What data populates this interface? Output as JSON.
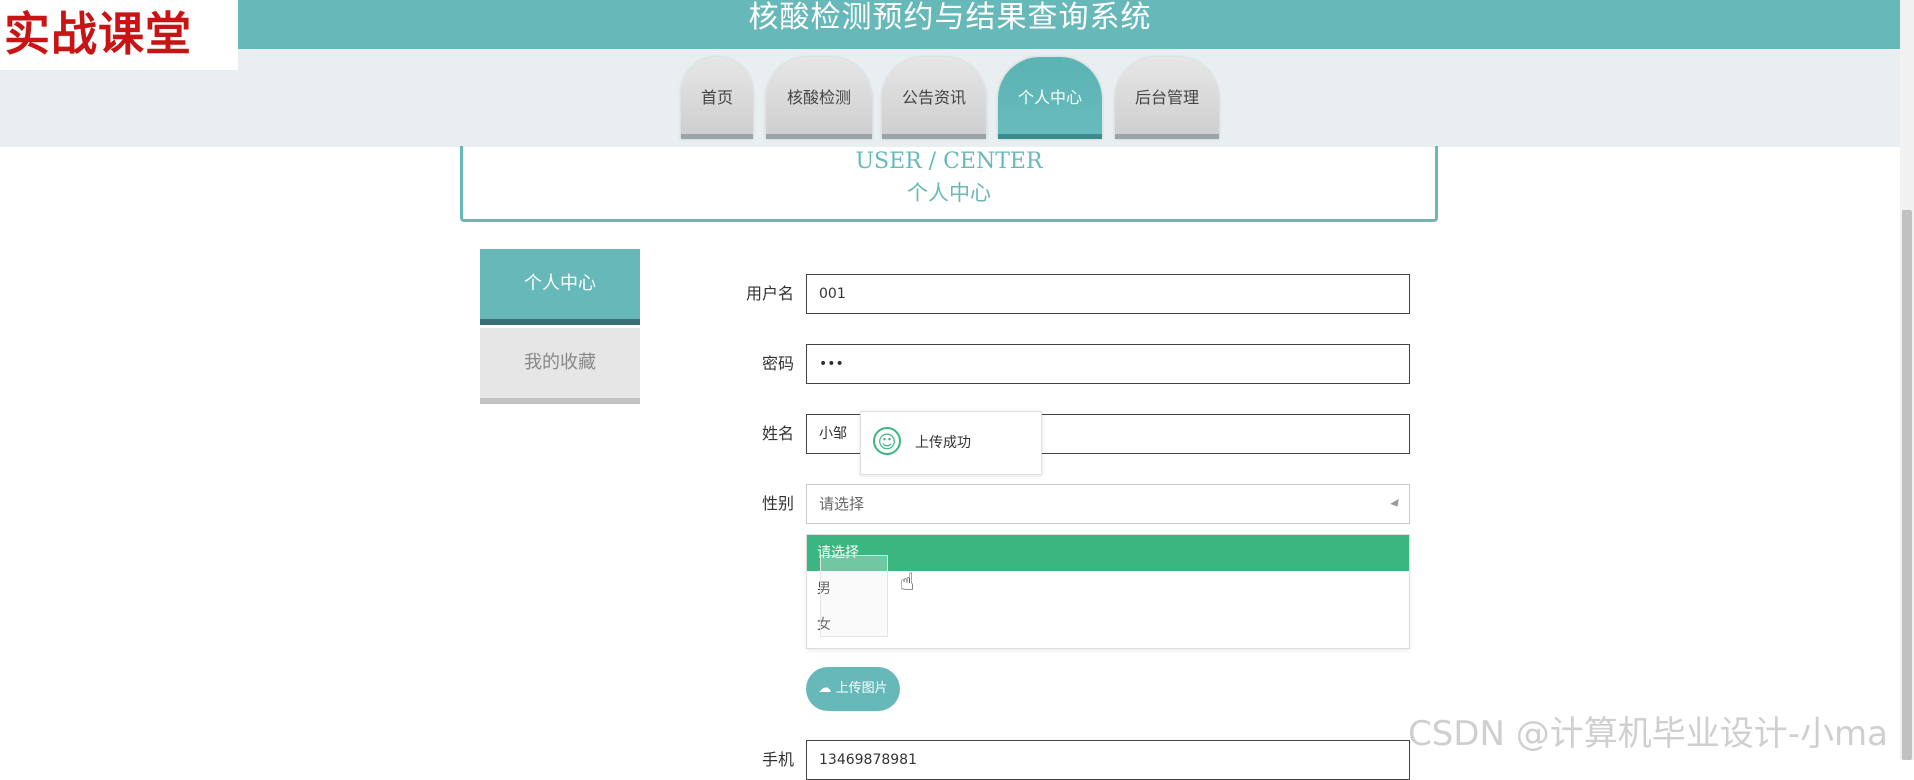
{
  "brand": {
    "logo_text": "实战课堂"
  },
  "header": {
    "site_title": "核酸检测预约与结果查询系统"
  },
  "nav": {
    "items": [
      {
        "label": "首页"
      },
      {
        "label": "核酸检测"
      },
      {
        "label": "公告资讯"
      },
      {
        "label": "个人中心"
      },
      {
        "label": "后台管理"
      }
    ],
    "active": "个人中心"
  },
  "section": {
    "title_en": "USER / CENTER",
    "title_cn": "个人中心"
  },
  "sidebar": {
    "items": [
      {
        "label": "个人中心"
      },
      {
        "label": "我的收藏"
      }
    ]
  },
  "form": {
    "username_label": "用户名",
    "username_value": "001",
    "password_label": "密码",
    "password_value": "•••",
    "name_label": "姓名",
    "name_value": "小邹",
    "gender_label": "性别",
    "gender_value": "请选择",
    "gender_options": [
      "请选择",
      "男",
      "女"
    ],
    "upload_button": "上传图片",
    "phone_label": "手机",
    "phone_value": "13469878981"
  },
  "toast": {
    "message": "上传成功"
  },
  "watermark": "CSDN @计算机毕业设计-小ma",
  "colors": {
    "accent": "#67b9b9",
    "success": "#3bb680",
    "brand_red": "#c81414"
  }
}
